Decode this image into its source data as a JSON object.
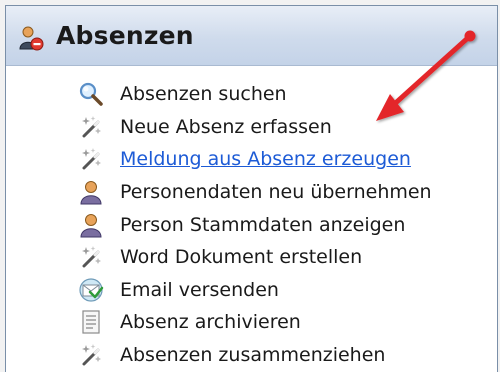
{
  "panel": {
    "title": "Absenzen",
    "title_icon": "person-absence-icon",
    "items": [
      {
        "label": "Absenzen suchen",
        "icon": "search-icon",
        "is_link": false
      },
      {
        "label": "Neue Absenz erfassen",
        "icon": "magic-wand-icon",
        "is_link": false
      },
      {
        "label": "Meldung aus Absenz erzeugen",
        "icon": "magic-wand-icon",
        "is_link": true
      },
      {
        "label": "Personendaten neu übernehmen",
        "icon": "person-icon",
        "is_link": false
      },
      {
        "label": "Person Stammdaten anzeigen",
        "icon": "person-icon",
        "is_link": false
      },
      {
        "label": "Word Dokument erstellen",
        "icon": "magic-wand-icon",
        "is_link": false
      },
      {
        "label": "Email versenden",
        "icon": "email-icon",
        "is_link": false
      },
      {
        "label": "Absenz archivieren",
        "icon": "document-icon",
        "is_link": false
      },
      {
        "label": "Absenzen zusammenziehen",
        "icon": "magic-wand-icon",
        "is_link": false
      }
    ]
  },
  "colors": {
    "header_bg": "#c9d7eb",
    "link": "#1d5bd6",
    "annotation_arrow": "#e3262c"
  }
}
